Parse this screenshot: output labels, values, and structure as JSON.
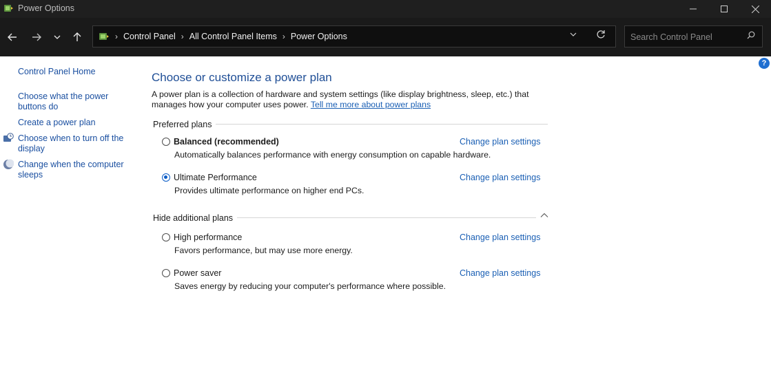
{
  "window": {
    "title": "Power Options"
  },
  "nav": {
    "breadcrumb": [
      "Control Panel",
      "All Control Panel Items",
      "Power Options"
    ],
    "search_placeholder": "Search Control Panel"
  },
  "sidebar": {
    "home": "Control Panel Home",
    "items": [
      "Choose what the power buttons do",
      "Create a power plan",
      "Choose when to turn off the display",
      "Change when the computer sleeps"
    ]
  },
  "main": {
    "heading": "Choose or customize a power plan",
    "description": "A power plan is a collection of hardware and system settings (like display brightness, sleep, etc.) that manages how your computer uses power.",
    "learn_more": "Tell me more about power plans",
    "preferred_label": "Preferred plans",
    "additional_label": "Hide additional plans",
    "change_link": "Change plan settings",
    "plans": [
      {
        "name": "Balanced (recommended)",
        "desc": "Automatically balances performance with energy consumption on capable hardware.",
        "selected": false
      },
      {
        "name": "Ultimate Performance",
        "desc": "Provides ultimate performance on higher end PCs.",
        "selected": true
      },
      {
        "name": "High performance",
        "desc": "Favors performance, but may use more energy.",
        "selected": false
      },
      {
        "name": "Power saver",
        "desc": "Saves energy by reducing your computer's performance where possible.",
        "selected": false
      }
    ]
  },
  "colors": {
    "link": "#1a5fb4",
    "heading": "#1f4e96",
    "titlebar": "#1f1f1f",
    "radio_selected": "#0a5cc7"
  },
  "icons": [
    "power-options-icon",
    "back-arrow-icon",
    "forward-arrow-icon",
    "chevron-down-icon",
    "up-arrow-icon",
    "refresh-icon",
    "search-icon",
    "help-icon",
    "display-timer-icon",
    "moon-sleep-icon",
    "chevron-up-icon"
  ]
}
